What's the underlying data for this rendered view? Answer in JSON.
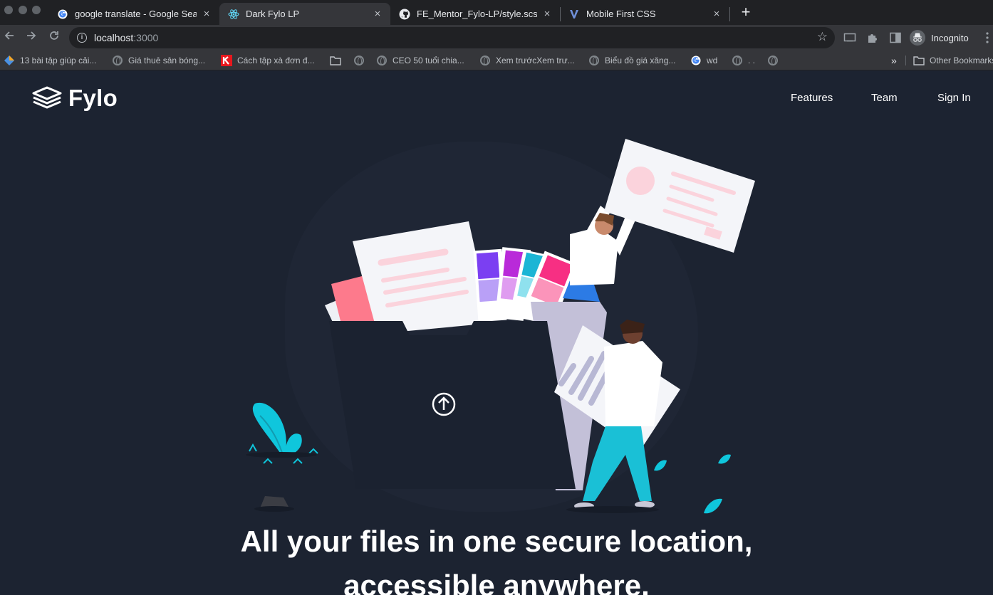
{
  "browser": {
    "tabs": [
      {
        "title": "google translate - Google Sear",
        "favicon": "google-icon",
        "active": false
      },
      {
        "title": "Dark Fylo LP",
        "favicon": "react-icon",
        "active": true
      },
      {
        "title": "FE_Mentor_Fylo-LP/style.scss",
        "favicon": "github-icon",
        "active": false
      },
      {
        "title": "Mobile First CSS",
        "favicon": "v-icon",
        "active": false
      }
    ],
    "close_glyph": "×",
    "new_tab_glyph": "+",
    "address": {
      "host": "localhost",
      "port": ":3000"
    },
    "profile_label": "Incognito",
    "bookmarks": [
      {
        "label": "13 bài tập giúp cải...",
        "icon": "diamond-icon"
      },
      {
        "label": "Giá thuê sân bóng...",
        "icon": "globe-icon"
      },
      {
        "label": "Cách tập xà đơn đ...",
        "icon": "k-icon"
      },
      {
        "label": "",
        "icon": "folder-icon"
      },
      {
        "label": "",
        "icon": "globe-icon"
      },
      {
        "label": "CEO 50 tuổi chia...",
        "icon": "globe-icon"
      },
      {
        "label": "Xem trướcXem trư...",
        "icon": "globe-icon"
      },
      {
        "label": "Biểu đồ giá xăng...",
        "icon": "globe-icon"
      },
      {
        "label": "wd",
        "icon": "google-icon"
      },
      {
        "label": ". .",
        "icon": "globe-icon"
      },
      {
        "label": "",
        "icon": "globe-icon"
      }
    ],
    "overflow_glyph": "»",
    "other_bookmarks": "Other Bookmarks"
  },
  "site": {
    "logo_text": "Fylo",
    "nav": [
      "Features",
      "Team",
      "Sign In"
    ],
    "headline_line1": "All your files in one secure location,",
    "headline_line2": "accessible anywhere."
  },
  "colors": {
    "page_bg": "#1c2331",
    "folder": "#1b2230",
    "accent_cyan": "#0fc6dc",
    "pink": "#fd5d8c"
  }
}
